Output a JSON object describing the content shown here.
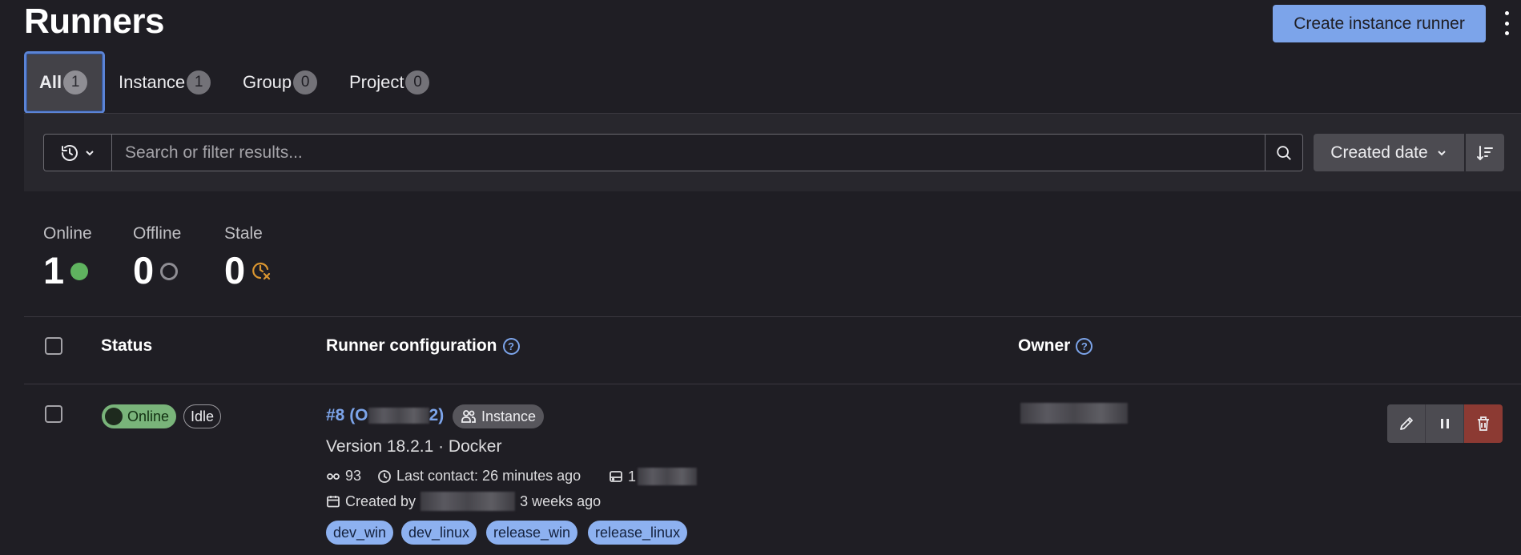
{
  "page": {
    "title": "Runners"
  },
  "header": {
    "create_button_label": "Create instance runner"
  },
  "tabs": [
    {
      "label": "All",
      "count": "1",
      "active": true
    },
    {
      "label": "Instance",
      "count": "1"
    },
    {
      "label": "Group",
      "count": "0"
    },
    {
      "label": "Project",
      "count": "0"
    }
  ],
  "search": {
    "placeholder": "Search or filter results...",
    "value": ""
  },
  "sort": {
    "label": "Created date"
  },
  "stats": [
    {
      "label": "Online",
      "value": "1",
      "icon": "online-dot-icon",
      "color": "#5fb35f"
    },
    {
      "label": "Offline",
      "value": "0",
      "icon": "offline-ring-icon",
      "color": "#8f8e94"
    },
    {
      "label": "Stale",
      "value": "0",
      "icon": "stale-clock-icon",
      "color": "#d99530"
    }
  ],
  "table": {
    "headers": {
      "status": "Status",
      "config": "Runner configuration",
      "owner": "Owner"
    },
    "rows": [
      {
        "status": "Online",
        "activity": "Idle",
        "runner_id_prefix": "#8 (O",
        "runner_id_suffix": "2)",
        "type_badge": "Instance",
        "version_line": "Version 18.2.1 · Docker",
        "jobs": "93",
        "last_contact": "Last contact: 26 minutes ago",
        "ip_prefix": "1",
        "created_by_label": "Created by",
        "created_ago": "3 weeks ago",
        "tags": [
          "dev_win",
          "dev_linux",
          "release_win",
          "release_linux"
        ]
      }
    ]
  },
  "colors": {
    "accent": "#7ca4ea",
    "background": "#1f1e24",
    "online": "#79b47a",
    "danger": "#8c3a33"
  }
}
